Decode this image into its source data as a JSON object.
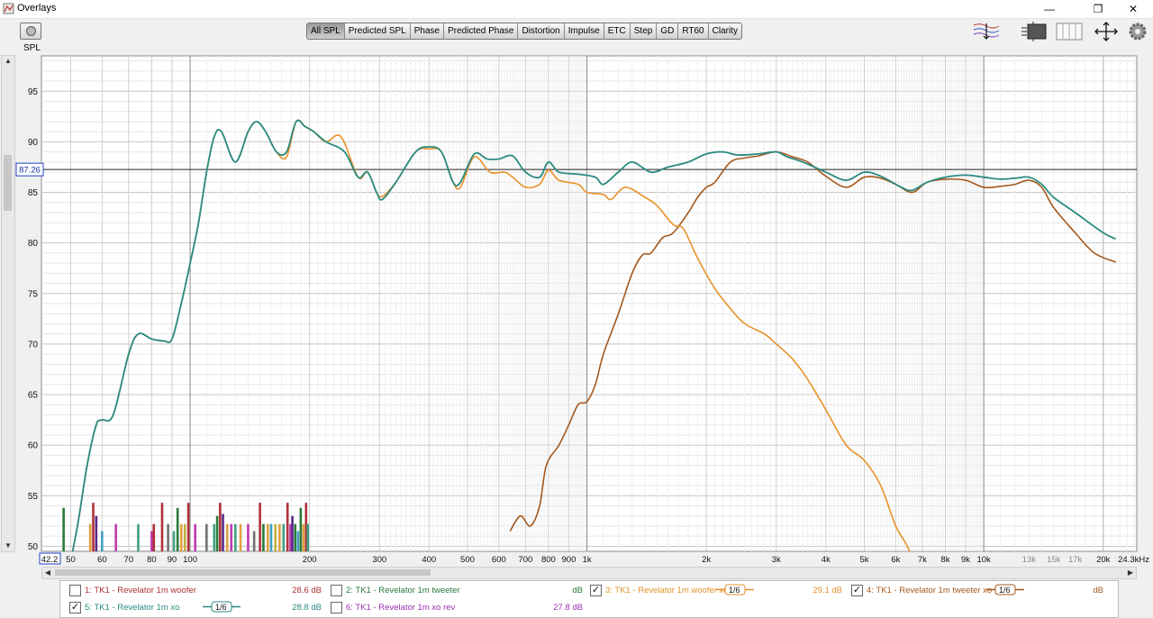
{
  "window": {
    "title": "Overlays",
    "minimize": "—",
    "restore": "❐",
    "close": "✕"
  },
  "toolbar": {
    "y_axis_label": "SPL",
    "tabs": [
      "All SPL",
      "Predicted SPL",
      "Phase",
      "Predicted Phase",
      "Distortion",
      "Impulse",
      "ETC",
      "Step",
      "GD",
      "RT60",
      "Clarity"
    ],
    "active_tab": "All SPL",
    "icons": [
      "camera-icon",
      "trace-arrange-icon",
      "limits-icon",
      "controls-icon",
      "pan-zoom-icon",
      "gear-icon"
    ]
  },
  "chart_data": {
    "type": "line",
    "x_scale": "log",
    "xlim": [
      42.2,
      24300
    ],
    "ylim": [
      49.5,
      98.5
    ],
    "y_ticks": [
      50,
      55,
      60,
      65,
      70,
      75,
      80,
      85,
      90,
      95
    ],
    "x_tick_labels": [
      {
        "f": 50,
        "t": "50"
      },
      {
        "f": 60,
        "t": "60"
      },
      {
        "f": 70,
        "t": "70"
      },
      {
        "f": 80,
        "t": "80"
      },
      {
        "f": 90,
        "t": "90"
      },
      {
        "f": 100,
        "t": "100"
      },
      {
        "f": 200,
        "t": "200"
      },
      {
        "f": 300,
        "t": "300"
      },
      {
        "f": 400,
        "t": "400"
      },
      {
        "f": 500,
        "t": "500"
      },
      {
        "f": 600,
        "t": "600"
      },
      {
        "f": 700,
        "t": "700"
      },
      {
        "f": 800,
        "t": "800"
      },
      {
        "f": 900,
        "t": "900"
      },
      {
        "f": 1000,
        "t": "1k"
      },
      {
        "f": 2000,
        "t": "2k"
      },
      {
        "f": 3000,
        "t": "3k"
      },
      {
        "f": 4000,
        "t": "4k"
      },
      {
        "f": 5000,
        "t": "5k"
      },
      {
        "f": 6000,
        "t": "6k"
      },
      {
        "f": 7000,
        "t": "7k"
      },
      {
        "f": 8000,
        "t": "8k"
      },
      {
        "f": 9000,
        "t": "9k"
      },
      {
        "f": 10000,
        "t": "10k"
      },
      {
        "f": 13000,
        "t": "13k"
      },
      {
        "f": 15000,
        "t": "15k"
      },
      {
        "f": 17000,
        "t": "17k"
      },
      {
        "f": 20000,
        "t": "20k"
      }
    ],
    "x_min_label": "42.2",
    "x_end_label": "24.3kHz",
    "cursor_db": 87.26,
    "cursor_label": "87.26",
    "series": [
      {
        "name": "TK1 - Revelator 1m xo",
        "color": "#2a8a80",
        "width": 1.8,
        "points": [
          [
            48,
            45
          ],
          [
            52,
            52
          ],
          [
            55,
            58
          ],
          [
            58,
            62
          ],
          [
            60,
            62.5
          ],
          [
            64,
            63
          ],
          [
            70,
            69
          ],
          [
            74,
            71
          ],
          [
            80,
            70.5
          ],
          [
            86,
            70.3
          ],
          [
            90,
            70.5
          ],
          [
            95,
            74
          ],
          [
            100,
            78
          ],
          [
            105,
            82
          ],
          [
            110,
            87
          ],
          [
            115,
            90.5
          ],
          [
            120,
            91
          ],
          [
            130,
            88
          ],
          [
            140,
            91
          ],
          [
            147,
            92
          ],
          [
            155,
            91
          ],
          [
            165,
            89
          ],
          [
            175,
            89
          ],
          [
            185,
            92
          ],
          [
            195,
            91.5
          ],
          [
            205,
            91
          ],
          [
            220,
            90
          ],
          [
            245,
            89
          ],
          [
            265,
            86.5
          ],
          [
            280,
            87
          ],
          [
            295,
            85
          ],
          [
            305,
            84.3
          ],
          [
            330,
            86
          ],
          [
            370,
            89
          ],
          [
            400,
            89.5
          ],
          [
            430,
            89
          ],
          [
            460,
            86
          ],
          [
            480,
            86
          ],
          [
            520,
            88.8
          ],
          [
            560,
            88.3
          ],
          [
            600,
            88.3
          ],
          [
            650,
            88.6
          ],
          [
            700,
            87
          ],
          [
            760,
            86.5
          ],
          [
            800,
            88
          ],
          [
            850,
            87
          ],
          [
            950,
            86.8
          ],
          [
            1050,
            86.5
          ],
          [
            1100,
            85.8
          ],
          [
            1200,
            87
          ],
          [
            1300,
            88
          ],
          [
            1450,
            87
          ],
          [
            1600,
            87.5
          ],
          [
            1800,
            88
          ],
          [
            2000,
            88.8
          ],
          [
            2200,
            89
          ],
          [
            2400,
            88.7
          ],
          [
            2700,
            88.8
          ],
          [
            3000,
            89
          ],
          [
            3200,
            88.5
          ],
          [
            3500,
            88
          ],
          [
            4000,
            87
          ],
          [
            4500,
            86.2
          ],
          [
            5000,
            87
          ],
          [
            5500,
            86.6
          ],
          [
            6200,
            85.5
          ],
          [
            6600,
            85.2
          ],
          [
            7200,
            86
          ],
          [
            8000,
            86.5
          ],
          [
            9000,
            86.7
          ],
          [
            10000,
            86.5
          ],
          [
            11000,
            86.3
          ],
          [
            12000,
            86.4
          ],
          [
            13000,
            86.5
          ],
          [
            14000,
            85.8
          ],
          [
            15000,
            84.5
          ],
          [
            17000,
            83
          ],
          [
            20000,
            81
          ],
          [
            21500,
            80.4
          ]
        ]
      },
      {
        "name": "TK1 - Revelator 1m woofer xo",
        "color": "#e8922a",
        "width": 1.6,
        "points": [
          [
            48,
            45
          ],
          [
            52,
            52
          ],
          [
            55,
            58
          ],
          [
            58,
            62
          ],
          [
            60,
            62.5
          ],
          [
            64,
            63
          ],
          [
            70,
            69
          ],
          [
            74,
            71
          ],
          [
            80,
            70.5
          ],
          [
            86,
            70.3
          ],
          [
            90,
            70.5
          ],
          [
            95,
            74
          ],
          [
            100,
            78
          ],
          [
            105,
            82
          ],
          [
            110,
            87
          ],
          [
            115,
            90.5
          ],
          [
            120,
            91
          ],
          [
            130,
            88
          ],
          [
            140,
            91
          ],
          [
            147,
            92
          ],
          [
            155,
            91
          ],
          [
            165,
            89
          ],
          [
            175,
            88.5
          ],
          [
            185,
            92
          ],
          [
            195,
            91.5
          ],
          [
            205,
            91
          ],
          [
            220,
            90
          ],
          [
            240,
            90.5
          ],
          [
            265,
            86.5
          ],
          [
            280,
            87
          ],
          [
            295,
            85
          ],
          [
            305,
            84.6
          ],
          [
            330,
            86
          ],
          [
            370,
            89
          ],
          [
            400,
            89.3
          ],
          [
            430,
            89
          ],
          [
            460,
            86
          ],
          [
            480,
            85.5
          ],
          [
            520,
            88.5
          ],
          [
            570,
            87
          ],
          [
            620,
            87
          ],
          [
            650,
            86.5
          ],
          [
            700,
            85.5
          ],
          [
            760,
            85.8
          ],
          [
            800,
            87.2
          ],
          [
            850,
            86.2
          ],
          [
            950,
            85.8
          ],
          [
            1000,
            85
          ],
          [
            1100,
            84.8
          ],
          [
            1150,
            84.3
          ],
          [
            1250,
            85.5
          ],
          [
            1400,
            84.5
          ],
          [
            1500,
            83.7
          ],
          [
            1650,
            81.8
          ],
          [
            1750,
            81.4
          ],
          [
            1900,
            78.5
          ],
          [
            2100,
            75.5
          ],
          [
            2300,
            73.5
          ],
          [
            2500,
            72
          ],
          [
            2800,
            71
          ],
          [
            3000,
            70
          ],
          [
            3300,
            68.5
          ],
          [
            3600,
            66.5
          ],
          [
            4000,
            63.5
          ],
          [
            4500,
            60
          ],
          [
            5000,
            58.5
          ],
          [
            5500,
            56
          ],
          [
            6000,
            52
          ],
          [
            6500,
            49.5
          ],
          [
            7000,
            45
          ]
        ]
      },
      {
        "name": "TK1 - Revelator 1m tweeter xo",
        "color": "#a4581c",
        "width": 1.6,
        "points": [
          [
            640,
            51.5
          ],
          [
            680,
            53
          ],
          [
            720,
            52
          ],
          [
            760,
            54
          ],
          [
            790,
            58
          ],
          [
            850,
            60
          ],
          [
            900,
            62
          ],
          [
            950,
            64
          ],
          [
            1000,
            64.3
          ],
          [
            1050,
            66
          ],
          [
            1100,
            69
          ],
          [
            1200,
            73
          ],
          [
            1300,
            77
          ],
          [
            1380,
            78.8
          ],
          [
            1450,
            79
          ],
          [
            1550,
            80.5
          ],
          [
            1650,
            81
          ],
          [
            1800,
            83
          ],
          [
            1900,
            84.5
          ],
          [
            2000,
            85.5
          ],
          [
            2100,
            86
          ],
          [
            2300,
            88
          ],
          [
            2500,
            88.4
          ],
          [
            2700,
            88.6
          ],
          [
            3000,
            89
          ],
          [
            3300,
            88.5
          ],
          [
            3600,
            88
          ],
          [
            4000,
            86.6
          ],
          [
            4500,
            85.5
          ],
          [
            5000,
            86.5
          ],
          [
            5500,
            86.4
          ],
          [
            6000,
            85.8
          ],
          [
            6600,
            85
          ],
          [
            7200,
            86
          ],
          [
            8000,
            86.3
          ],
          [
            9000,
            86.2
          ],
          [
            10000,
            85.5
          ],
          [
            11000,
            85.6
          ],
          [
            12000,
            85.8
          ],
          [
            13000,
            86.2
          ],
          [
            14000,
            85.5
          ],
          [
            15000,
            83.5
          ],
          [
            17000,
            81
          ],
          [
            19000,
            79
          ],
          [
            21500,
            78.1
          ]
        ]
      }
    ],
    "bars": [
      {
        "f": 48,
        "v": 53.8,
        "c": "#2a7a3a"
      },
      {
        "f": 56,
        "v": 52.2,
        "c": "#e0a040"
      },
      {
        "f": 57,
        "v": 54.3,
        "c": "#b0303a"
      },
      {
        "f": 58,
        "v": 53,
        "c": "#5a2a8a"
      },
      {
        "f": 60,
        "v": 51.5,
        "c": "#40a0c0"
      },
      {
        "f": 65,
        "v": 52.2,
        "c": "#c03ab0"
      },
      {
        "f": 74,
        "v": 52.2,
        "c": "#40a080"
      },
      {
        "f": 80,
        "v": 51.5,
        "c": "#c03ab0"
      },
      {
        "f": 81,
        "v": 52.2,
        "c": "#b0303a"
      },
      {
        "f": 85,
        "v": 54.3,
        "c": "#b0303a"
      },
      {
        "f": 88,
        "v": 52.2,
        "c": "#707070"
      },
      {
        "f": 91,
        "v": 51.5,
        "c": "#40a080"
      },
      {
        "f": 93,
        "v": 53.8,
        "c": "#2a7a3a"
      },
      {
        "f": 95,
        "v": 52.2,
        "c": "#e0a040"
      },
      {
        "f": 97,
        "v": 52.2,
        "c": "#c0b040"
      },
      {
        "f": 99,
        "v": 54.3,
        "c": "#b0303a"
      },
      {
        "f": 103,
        "v": 52.2,
        "c": "#c03ab0"
      },
      {
        "f": 110,
        "v": 52.2,
        "c": "#707070"
      },
      {
        "f": 115,
        "v": 52.2,
        "c": "#40a080"
      },
      {
        "f": 117,
        "v": 53,
        "c": "#2a7a3a"
      },
      {
        "f": 119,
        "v": 54.3,
        "c": "#b0303a"
      },
      {
        "f": 121,
        "v": 53.2,
        "c": "#5a2a8a"
      },
      {
        "f": 124,
        "v": 52.2,
        "c": "#e0a040"
      },
      {
        "f": 127,
        "v": 52.2,
        "c": "#c03ab0"
      },
      {
        "f": 130,
        "v": 52.2,
        "c": "#40a080"
      },
      {
        "f": 134,
        "v": 52.2,
        "c": "#e0a040"
      },
      {
        "f": 140,
        "v": 52.2,
        "c": "#c03ab0"
      },
      {
        "f": 145,
        "v": 51.5,
        "c": "#707070"
      },
      {
        "f": 150,
        "v": 54.3,
        "c": "#b0303a"
      },
      {
        "f": 153,
        "v": 52.2,
        "c": "#2a7a3a"
      },
      {
        "f": 157,
        "v": 52.2,
        "c": "#e0a040"
      },
      {
        "f": 160,
        "v": 52.2,
        "c": "#40a0c0"
      },
      {
        "f": 164,
        "v": 52.2,
        "c": "#c0b040"
      },
      {
        "f": 168,
        "v": 52.2,
        "c": "#e0a040"
      },
      {
        "f": 172,
        "v": 52.2,
        "c": "#40a080"
      },
      {
        "f": 176,
        "v": 54.3,
        "c": "#b0303a"
      },
      {
        "f": 179,
        "v": 52.2,
        "c": "#c03ab0"
      },
      {
        "f": 181,
        "v": 53,
        "c": "#5a2a8a"
      },
      {
        "f": 184,
        "v": 52.2,
        "c": "#2a7a3a"
      },
      {
        "f": 187,
        "v": 51.5,
        "c": "#40a0c0"
      },
      {
        "f": 190,
        "v": 53.8,
        "c": "#2a7a3a"
      },
      {
        "f": 193,
        "v": 52.2,
        "c": "#e0a040"
      },
      {
        "f": 196,
        "v": 54.3,
        "c": "#b0303a"
      },
      {
        "f": 198,
        "v": 52.2,
        "c": "#40a080"
      }
    ]
  },
  "legend": [
    {
      "id": 1,
      "label": "1: TK1 - Revelator 1m woofer",
      "value": "28.6 dB",
      "checked": false,
      "color": "#b03030",
      "smoothing": ""
    },
    {
      "id": 2,
      "label": "2: TK1 - Revelator 1m tweeter",
      "value": "dB",
      "checked": false,
      "color": "#2a7a3a",
      "smoothing": ""
    },
    {
      "id": 3,
      "label": "3: TK1 - Revelator 1m woofer xo",
      "value": "29.1 dB",
      "checked": true,
      "color": "#e0922a",
      "smoothing": "1/6"
    },
    {
      "id": 4,
      "label": "4: TK1 - Revelator 1m tweeter xo",
      "value": "dB",
      "checked": true,
      "color": "#a4581c",
      "smoothing": "1/6"
    },
    {
      "id": 5,
      "label": "5: TK1 - Revelator 1m xo",
      "value": "28.8 dB",
      "checked": true,
      "color": "#2a8a80",
      "smoothing": "1/6"
    },
    {
      "id": 6,
      "label": "6: TK1 - Revelator 1m xo rev",
      "value": "27.8 dB",
      "checked": false,
      "color": "#9a30b0",
      "smoothing": ""
    }
  ]
}
